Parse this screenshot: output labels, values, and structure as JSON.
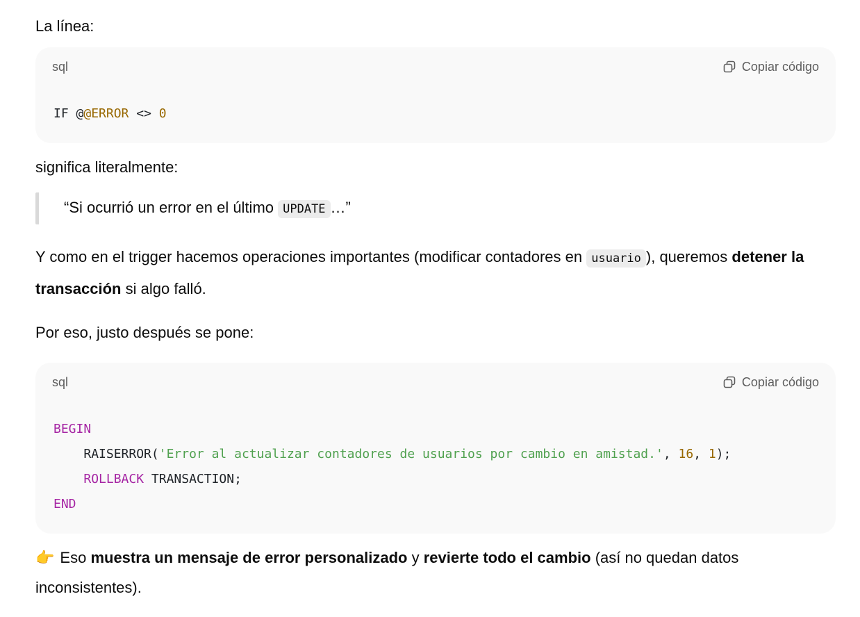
{
  "intro_text": "La línea:",
  "code_block_1": {
    "language": "sql",
    "copy_label": "Copiar código",
    "tokens": {
      "if": "IF @",
      "error": "@ERROR",
      "op": " <> ",
      "zero": "0"
    }
  },
  "signifies_text": "significa literalmente:",
  "quote": {
    "before": "“Si ocurrió un error en el último ",
    "code": "UPDATE",
    "after": "…”"
  },
  "paragraph_because": {
    "part1": "Y como en el trigger hacemos operaciones importantes (modificar contadores en ",
    "code": "usuario",
    "part2": "), queremos ",
    "bold": "detener la transacción",
    "part3": " si algo falló."
  },
  "therefore_text": "Por eso, justo después se pone:",
  "code_block_2": {
    "language": "sql",
    "copy_label": "Copiar código",
    "tokens": {
      "begin": "BEGIN",
      "indent": "    ",
      "raiserror": "RAISERROR(",
      "message": "'Error al actualizar contadores de usuarios por cambio en amistad.'",
      "comma1": ", ",
      "severity": "16",
      "comma2": ", ",
      "state": "1",
      "close": ");",
      "rollback": "ROLLBACK",
      "transaction": " TRANSACTION;",
      "end": "END"
    }
  },
  "result": {
    "icon": "👉",
    "part1": "Eso ",
    "bold1": "muestra un mensaje de error personalizado",
    "part2": " y ",
    "bold2": "revierte todo el cambio",
    "part3": " (así no quedan datos inconsistentes)."
  }
}
